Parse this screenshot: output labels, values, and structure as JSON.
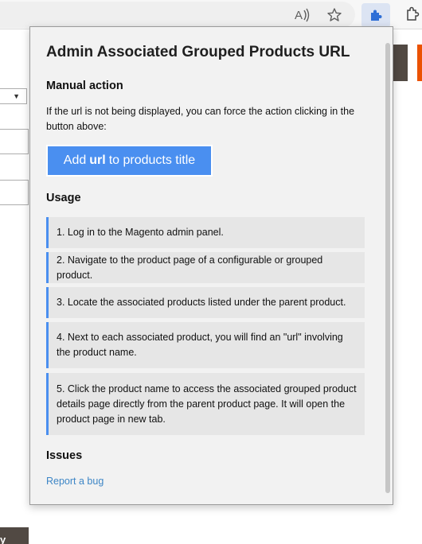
{
  "browser": {
    "toolbar_icons": [
      "read-aloud-icon",
      "favorite-star-icon",
      "extensions-puzzle-icon",
      "settings-icon"
    ]
  },
  "background_page": {
    "bottom_button_label": "y"
  },
  "popup": {
    "title": "Admin Associated Grouped Products URL",
    "manual_action": {
      "heading": "Manual action",
      "description": "If the url is not being displayed, you can force the action clicking in the button above:",
      "button": {
        "prefix": "Add",
        "bold": "url",
        "suffix": "to products title"
      }
    },
    "usage": {
      "heading": "Usage",
      "steps": [
        "1. Log in to the Magento admin panel.",
        "2. Navigate to the product page of a configurable or grouped product.",
        "3. Locate the associated products listed under the parent product.",
        "4. Next to each associated product, you will find an \"url\" involving the product name.",
        "5. Click the product name to access the associated grouped product details page directly from the parent product page. It will open the product page in new tab."
      ]
    },
    "issues": {
      "heading": "Issues",
      "link": "Report a bug"
    }
  },
  "colors": {
    "accent": "#4a8ff0",
    "link": "#3d86c6",
    "popup_bg": "#f2f2f2",
    "step_bg": "#e6e6e6"
  }
}
